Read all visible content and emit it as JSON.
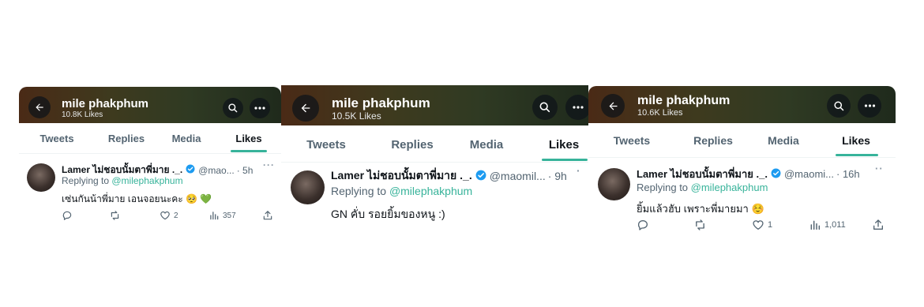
{
  "panels": [
    {
      "profile_name": "mile phakphum",
      "likes_count": "10.8K Likes",
      "tabs": [
        "Tweets",
        "Replies",
        "Media",
        "Likes"
      ],
      "tweet": {
        "author": "Lamer ไม่ชอบนั้มตาพี่มาย ._.",
        "handle": "@mao...",
        "time": "· 5h",
        "replying_label": "Replying to ",
        "replying_handle": "@milephakphum",
        "text": "เซ่นกันน้าพี่มาย เอนจอยนะคะ 🥺 💚",
        "likes": "2",
        "views": "357"
      }
    },
    {
      "profile_name": "mile phakphum",
      "likes_count": "10.5K Likes",
      "tabs": [
        "Tweets",
        "Replies",
        "Media",
        "Likes"
      ],
      "tweet": {
        "author": "Lamer ไม่ชอบนั้มตาพี่มาย ._.",
        "handle": "@maomil...",
        "time": "· 9h",
        "replying_label": "Replying to ",
        "replying_handle": "@milephakphum",
        "text": "GN คั่บ รอยยิ้มของหนู :)",
        "likes": "",
        "views": ""
      }
    },
    {
      "profile_name": "mile phakphum",
      "likes_count": "10.6K Likes",
      "tabs": [
        "Tweets",
        "Replies",
        "Media",
        "Likes"
      ],
      "tweet": {
        "author": "Lamer ไม่ชอบนั้มตาพี่มาย ._.",
        "handle": "@maomi...",
        "time": "· 16h",
        "replying_label": "Replying to ",
        "replying_handle": "@milephakphum",
        "text": "ยิ้มแล้วฮับ เพราะพี่มายมา ☺️",
        "likes": "1",
        "views": "1,011"
      }
    }
  ],
  "colors": {
    "accent": "#37b39a",
    "verified": "#1d9bf0",
    "muted": "#536471"
  },
  "icons": [
    "back-arrow-icon",
    "search-icon",
    "more-icon",
    "verified-badge-icon",
    "reply-icon",
    "retweet-icon",
    "like-icon",
    "views-icon",
    "share-icon"
  ]
}
